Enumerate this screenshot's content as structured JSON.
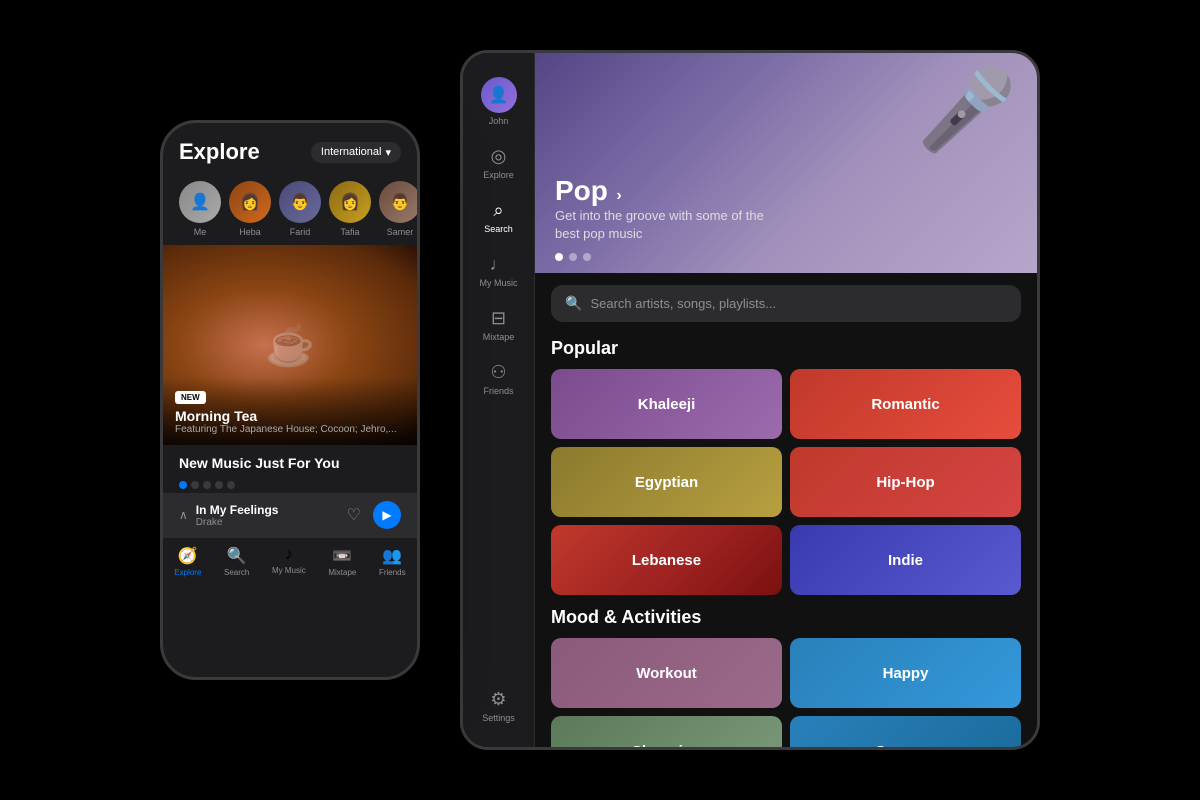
{
  "phone": {
    "header": {
      "title": "Explore",
      "dropdown_label": "International",
      "dropdown_arrow": "▾"
    },
    "avatars": [
      {
        "id": "me",
        "label": "Me",
        "class": "av-me",
        "emoji": "👤"
      },
      {
        "id": "heba",
        "label": "Heba",
        "class": "av-heba",
        "emoji": "👩"
      },
      {
        "id": "farid",
        "label": "Farid",
        "class": "av-farid",
        "emoji": "👨"
      },
      {
        "id": "tafia",
        "label": "Tafia",
        "class": "av-tafia",
        "emoji": "👩"
      },
      {
        "id": "samer",
        "label": "Samer",
        "class": "av-samer",
        "emoji": "👨"
      }
    ],
    "hero": {
      "badge": "NEW",
      "title": "Morning Tea",
      "subtitle": "Featuring The Japanese House; Cocoon; Jehro,..."
    },
    "new_music_section": "New Music Just For You",
    "dots": [
      true,
      false,
      false,
      false,
      false
    ],
    "now_playing": {
      "title": "In My Feelings",
      "artist": "Drake"
    },
    "nav_items": [
      {
        "label": "Explore",
        "icon": "🧭",
        "active": true
      },
      {
        "label": "Search",
        "icon": "🔍",
        "active": false
      },
      {
        "label": "My Music",
        "icon": "♪",
        "active": false
      },
      {
        "label": "Mixtape",
        "icon": "📼",
        "active": false
      },
      {
        "label": "Friends",
        "icon": "👥",
        "active": false
      }
    ]
  },
  "tablet": {
    "sidebar": {
      "items": [
        {
          "id": "john",
          "label": "John",
          "type": "avatar"
        },
        {
          "id": "explore",
          "label": "Explore",
          "icon": "◉"
        },
        {
          "id": "search",
          "label": "Search",
          "icon": "⌕",
          "active": true
        },
        {
          "id": "my-music",
          "label": "My Music",
          "icon": "♩"
        },
        {
          "id": "mixtape",
          "label": "Mixtape",
          "icon": "⊟"
        },
        {
          "id": "friends",
          "label": "Friends",
          "icon": "⚇"
        }
      ],
      "bottom": [
        {
          "id": "settings",
          "label": "Settings",
          "icon": "⚙"
        }
      ]
    },
    "hero": {
      "title": "Pop",
      "arrow": "›",
      "subtitle": "Get into the groove with some of the best pop music",
      "dots": [
        true,
        false,
        false
      ]
    },
    "search": {
      "placeholder": "Search artists, songs, playlists..."
    },
    "popular_section": "Popular",
    "popular_genres": [
      {
        "id": "khaleeji",
        "label": "Khaleeji",
        "class": "genre-khaleeji"
      },
      {
        "id": "romantic",
        "label": "Romantic",
        "class": "genre-romantic"
      },
      {
        "id": "egyptian",
        "label": "Egyptian",
        "class": "genre-egyptian"
      },
      {
        "id": "hiphop",
        "label": "Hip-Hop",
        "class": "genre-hiphop"
      },
      {
        "id": "lebanese",
        "label": "Lebanese",
        "class": "genre-lebanese"
      },
      {
        "id": "indie",
        "label": "Indie",
        "class": "genre-indie"
      }
    ],
    "mood_section": "Mood & Activities",
    "mood_genres": [
      {
        "id": "workout",
        "label": "Workout",
        "class": "genre-workout"
      },
      {
        "id": "happy",
        "label": "Happy",
        "class": "genre-happy"
      },
      {
        "id": "shopping",
        "label": "Shopping",
        "class": "genre-shopping"
      },
      {
        "id": "summer",
        "label": "Summer",
        "class": "genre-summer"
      }
    ]
  }
}
